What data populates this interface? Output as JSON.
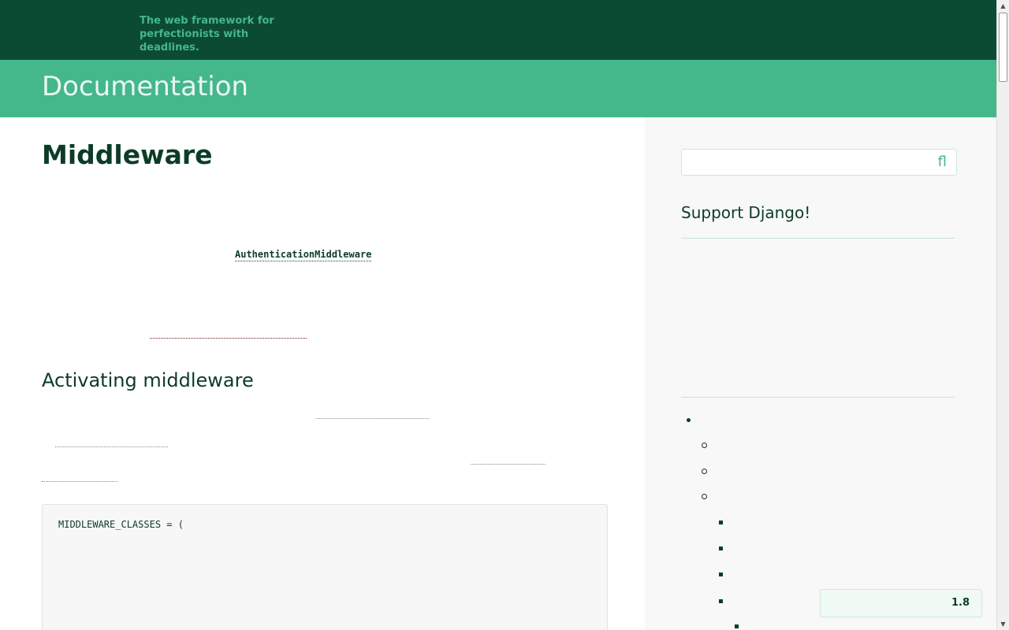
{
  "header": {
    "tagline": "The web framework for perfectionists with deadlines.",
    "doc_title": "Documentation"
  },
  "main": {
    "page_title": "Middleware",
    "inline_code": "AuthenticationMiddleware",
    "section_title": "Activating middleware",
    "code_block": {
      "first_line": "MIDDLEWARE_CLASSES = ("
    }
  },
  "sidebar": {
    "search": {
      "value": "",
      "placeholder": "",
      "icon": "search-icon",
      "glyph": "ﬂ"
    },
    "support_title": "Support Django!"
  },
  "version_badge": {
    "label": "1.8"
  },
  "scrollbar": {
    "up_icon": "▲",
    "down_icon": "▼"
  },
  "colors": {
    "header_dark": "#0c4b33",
    "header_green": "#44b78b",
    "text_dark": "#0c3c26"
  }
}
